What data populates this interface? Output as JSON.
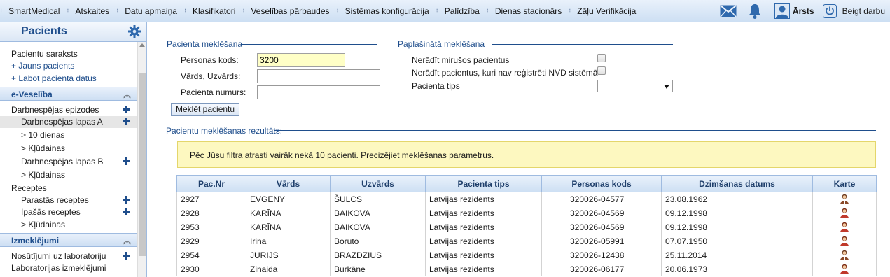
{
  "topbar": {
    "menu": [
      "SmartMedical",
      "Atskaites",
      "Datu apmaiņa",
      "Klasifikatori",
      "Veselības pārbaudes",
      "Sistēmas konfigurācija",
      "Palīdzība",
      "Dienas stacionārs",
      "Zāļu Verifikācija"
    ],
    "user_label": "Ārsts",
    "logout_label": "Beigt darbu",
    "icons": [
      "mail-icon",
      "bell-icon",
      "user-icon",
      "power-icon"
    ]
  },
  "sidebar": {
    "title": "Pacients",
    "patient_list": "Pacientu saraksts",
    "new_patient": "+ Jauns pacients",
    "edit_patient": "+ Labot pacienta datus",
    "eveseliba": "e-Veselība",
    "sick_leave": "Darbnespējas epizodes",
    "sick_a": "Darbnespējas lapas A",
    "ten_days": "> 10 dienas",
    "errors1": "> Kļūdainas",
    "sick_b": "Darbnespējas lapas B",
    "errors2": "> Kļūdainas",
    "recipes": "Receptes",
    "recipes_common": "Parastās receptes",
    "recipes_special": "Īpašās receptes",
    "errors3": "> Kļūdainas",
    "izmeklejumi": "Izmeklējumi",
    "lab_referrals": "Nosūtījumi uz laboratoriju",
    "lab_tests": "Laboratorijas izmeklējumi"
  },
  "search": {
    "legend": "Pacienta meklēšana",
    "personal_code_label": "Personas kods:",
    "personal_code_value": "3200",
    "name_label": "Vārds, Uzvārds:",
    "name_value": "",
    "patient_number_label": "Pacienta numurs:",
    "patient_number_value": "",
    "search_button": "Meklēt pacientu"
  },
  "extended": {
    "legend": "Paplašinātā meklēšana",
    "hide_deceased": "Nerādīt mirušos pacientus",
    "hide_unregistered": "Nerādīt pacientus, kuri nav reģistrēti NVD sistēmā",
    "patient_type": "Pacienta tips",
    "patient_type_value": ""
  },
  "results": {
    "legend": "Pacientu meklēšanas rezultāts:",
    "notice": "Pēc Jūsu filtra atrasti vairāk nekā 10 pacienti. Precizējiet meklēšanas parametrus.",
    "columns": [
      "Pac.Nr",
      "Vārds",
      "Uzvārds",
      "Pacienta tips",
      "Personas kods",
      "Dzimšanas datums",
      "Karte"
    ],
    "rows": [
      {
        "nr": "2927",
        "name": "EVGENY",
        "surname": "ŠULCS",
        "type": "Latvijas rezidents",
        "code": "320026-04577",
        "dob": "23.08.1962",
        "gender": "male"
      },
      {
        "nr": "2928",
        "name": "KARĪNA",
        "surname": "BAIKOVA",
        "type": "Latvijas rezidents",
        "code": "320026-04569",
        "dob": "09.12.1998",
        "gender": "female"
      },
      {
        "nr": "2953",
        "name": "KARĪNA",
        "surname": "BAIKOVA",
        "type": "Latvijas rezidents",
        "code": "320026-04569",
        "dob": "09.12.1998",
        "gender": "female"
      },
      {
        "nr": "2929",
        "name": "Irina",
        "surname": "Boruto",
        "type": "Latvijas rezidents",
        "code": "320026-05991",
        "dob": "07.07.1950",
        "gender": "female"
      },
      {
        "nr": "2954",
        "name": "JURIJS",
        "surname": "BRAZDZIUS",
        "type": "Latvijas rezidents",
        "code": "320026-12438",
        "dob": "25.11.2014",
        "gender": "male"
      },
      {
        "nr": "2930",
        "name": "Zinaida",
        "surname": "Burkāne",
        "type": "Latvijas rezidents",
        "code": "320026-06177",
        "dob": "20.06.1973",
        "gender": "female"
      }
    ]
  },
  "colors": {
    "accent": "#1f4e8c",
    "notice_bg": "#fdf8c0",
    "header_bg": "#cddff3",
    "female_card": "#c0392b",
    "male_card": "#8a4a2a"
  }
}
